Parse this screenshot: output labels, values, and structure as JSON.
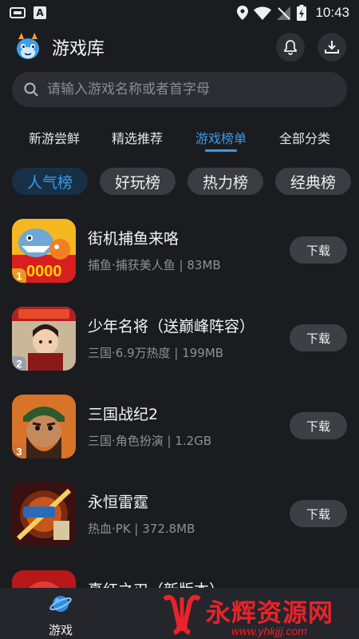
{
  "status_bar": {
    "time": "10:43",
    "badge_letter": "A",
    "icons": [
      "app-notification-icon",
      "a-notification-icon",
      "location-icon",
      "wifi-icon",
      "no-signal-icon",
      "battery-charging-icon"
    ]
  },
  "header": {
    "title": "游戏库",
    "logo_icon": "dragon-mascot-icon",
    "bell_icon": "bell-icon",
    "download_icon": "download-tray-icon"
  },
  "search": {
    "placeholder": "请输入游戏名称或者首字母",
    "icon": "search-icon"
  },
  "tabs": [
    {
      "label": "新游尝鲜",
      "active": false
    },
    {
      "label": "精选推荐",
      "active": false
    },
    {
      "label": "游戏榜单",
      "active": true
    },
    {
      "label": "全部分类",
      "active": false
    }
  ],
  "chips": [
    {
      "label": "人气榜",
      "active": true
    },
    {
      "label": "好玩榜",
      "active": false
    },
    {
      "label": "热力榜",
      "active": false
    },
    {
      "label": "经典榜",
      "active": false
    }
  ],
  "games": [
    {
      "rank": "1",
      "name": "街机捕鱼来咯",
      "meta": "捕鱼·捕获美人鱼 | 83MB",
      "button": "下载",
      "icon": "fishing-game-icon"
    },
    {
      "rank": "2",
      "name": "少年名将（送巅峰阵容）",
      "meta": "三国·6.9万热度 | 199MB",
      "button": "下载",
      "icon": "warrior-game-icon"
    },
    {
      "rank": "3",
      "name": "三国战纪2",
      "meta": "三国·角色扮演 | 1.2GB",
      "button": "下载",
      "icon": "general-game-icon"
    },
    {
      "rank": "",
      "name": "永恒雷霆",
      "meta": "热血·PK | 372.8MB",
      "button": "下载",
      "icon": "thunder-game-icon"
    },
    {
      "rank": "",
      "name": "真红之刃（新版本）",
      "meta": "",
      "button": "",
      "icon": "blade-game-icon"
    }
  ],
  "bottom_nav": {
    "label": "游戏",
    "icon": "planet-icon"
  },
  "watermark": {
    "text": "永辉资源网",
    "url": "www.yhkjjj.com"
  },
  "colors": {
    "background": "#1b1c20",
    "accent": "#3a9be8",
    "button": "#3d3f45",
    "watermark": "#e8232a"
  }
}
